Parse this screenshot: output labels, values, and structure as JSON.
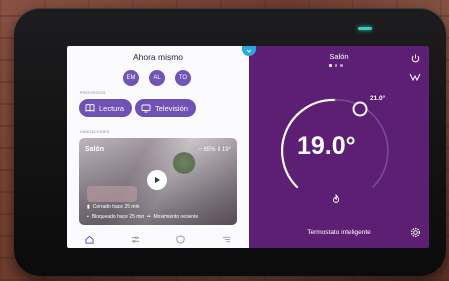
{
  "left_panel": {
    "title": "Ahora mismo",
    "people": [
      "EM",
      "AL",
      "TO"
    ],
    "scenes_label": "PREFERIDOS",
    "scenes": [
      "Lectura",
      "Televisión"
    ],
    "rooms_label": "HABITACIONES",
    "room_card": {
      "room": "Salón",
      "humidity": "65%",
      "temperature": "19°",
      "status_lines": [
        "Cerrado hace 25 min",
        "Bloqueado hace 25 min"
      ],
      "motion": "Movimiento reciente"
    }
  },
  "right_panel": {
    "title": "Salón",
    "current_temperature": "19.0°",
    "target_temperature": "21.0°",
    "footer": "Termostato inteligente"
  },
  "colors": {
    "accent": "#6e53b5",
    "thermostat_bg": "#5c1f74",
    "led": "#35d0b8",
    "notch": "#26a9e0"
  },
  "icons": [
    "power-icon",
    "flow-icon",
    "flame-icon",
    "settings-icon",
    "home-icon",
    "sliders-icon",
    "shield-icon",
    "menu-icon",
    "play-icon",
    "book-icon",
    "tv-icon",
    "droplet-icon",
    "thermometer-icon",
    "door-icon",
    "lock-icon",
    "motion-icon"
  ]
}
